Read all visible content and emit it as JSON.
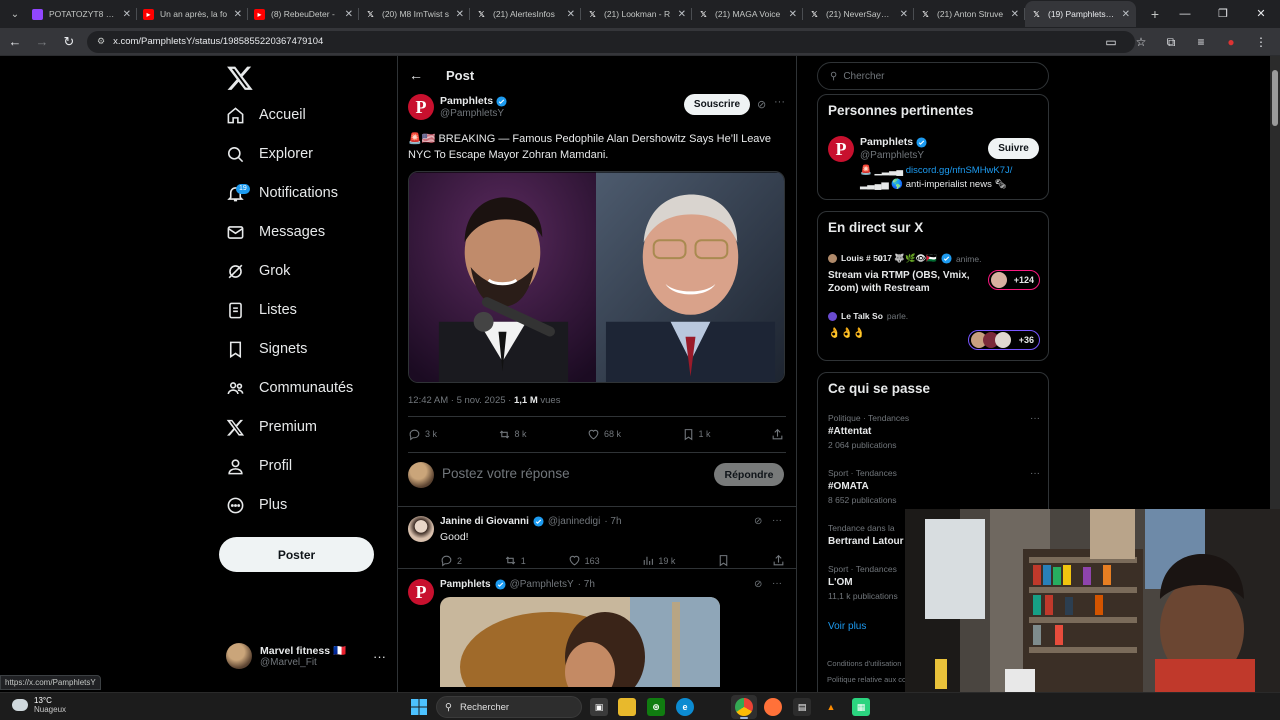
{
  "browser": {
    "tabs": [
      {
        "title": "POTATOZYT8 - Tw",
        "fav_color": "#9146ff",
        "active": false
      },
      {
        "title": "Un an après, la fo",
        "fav_color": "#ff0000",
        "active": false
      },
      {
        "title": "(8) RebeuDeter -",
        "fav_color": "#ff0000",
        "active": false
      },
      {
        "title": "(20) M8 ImTwist s",
        "fav_color": "#000000",
        "active": false
      },
      {
        "title": "(21) AlertesInfos",
        "fav_color": "#000000",
        "active": false
      },
      {
        "title": "(21) Lookman - R",
        "fav_color": "#000000",
        "active": false
      },
      {
        "title": "(21) MAGA Voice",
        "fav_color": "#000000",
        "active": false
      },
      {
        "title": "(21) NeverSayYes",
        "fav_color": "#000000",
        "active": false
      },
      {
        "title": "(21) Anton Struve",
        "fav_color": "#000000",
        "active": false
      },
      {
        "title": "(19) Pamphlets su",
        "fav_color": "#000000",
        "active": true
      }
    ],
    "url": "x.com/PamphletsY/status/1985855220367479104",
    "status_url": "https://x.com/PamphletsY"
  },
  "nav": {
    "items": [
      {
        "label": "Accueil",
        "icon": "home-icon"
      },
      {
        "label": "Explorer",
        "icon": "search-icon"
      },
      {
        "label": "Notifications",
        "icon": "bell-icon"
      },
      {
        "label": "Messages",
        "icon": "mail-icon"
      },
      {
        "label": "Grok",
        "icon": "grok-icon"
      },
      {
        "label": "Listes",
        "icon": "list-icon"
      },
      {
        "label": "Signets",
        "icon": "bookmark-icon"
      },
      {
        "label": "Communautés",
        "icon": "communities-icon"
      },
      {
        "label": "Premium",
        "icon": "x-premium-icon"
      },
      {
        "label": "Profil",
        "icon": "profile-icon"
      },
      {
        "label": "Plus",
        "icon": "more-circle-icon"
      }
    ],
    "notifications_badge": "19",
    "post_button": "Poster",
    "account": {
      "name": "Marvel fitness 🇫🇷",
      "handle": "@Marvel_Fit"
    }
  },
  "main": {
    "title": "Post",
    "author": {
      "name": "Pamphlets",
      "handle": "@PamphletsY"
    },
    "subscribe_label": "Souscrire",
    "text": "🚨🇺🇸 BREAKING — Famous Pedophile Alan Dershowitz Says He’ll Leave NYC To Escape Mayor Zohran Mamdani.",
    "time": "12:42 AM · 5 nov. 2025 · ",
    "views": "1,1 M",
    "views_label": " vues",
    "stats": {
      "replies": "3 k",
      "reposts": "8 k",
      "likes": "68 k",
      "bookmarks": "1 k"
    },
    "reply_placeholder": "Postez votre réponse",
    "reply_button": "Répondre",
    "replies": [
      {
        "name": "Janine di Giovanni",
        "handle": "@janinedigi",
        "time": "· 7h",
        "text": "Good!",
        "stats": {
          "replies": "2",
          "reposts": "1",
          "likes": "163",
          "views": "19 k"
        }
      },
      {
        "name": "Pamphlets",
        "handle": "@PamphletsY",
        "time": "· 7h"
      }
    ]
  },
  "right": {
    "search_placeholder": "Chercher",
    "relevant": {
      "title": "Personnes pertinentes",
      "name": "Pamphlets",
      "handle": "@PamphletsY",
      "follow": "Suivre",
      "bio_prefix": "🚨 ▁▂▃▄ ",
      "bio_link": "discord.gg/nfnSMHwK7J/",
      "bio_line2": "▂▃▄▅ 🌎 anti-imperialist news 🗞"
    },
    "live": {
      "title": "En direct sur X",
      "entries": [
        {
          "host": "Louis # 5𝟎17 🐺🌿👁🇵🇸",
          "action": "anime.",
          "title": "Stream via RTMP (OBS, Vmix, Zoom) with Restream",
          "count": "+124"
        },
        {
          "host": "Le Talk So",
          "action": "parle.",
          "title": "👌👌👌",
          "count": "+36"
        }
      ]
    },
    "trends": {
      "title": "Ce qui se passe",
      "items": [
        {
          "category": "Politique · Tendances",
          "tag": "#Attentat",
          "count": "2 064 publications"
        },
        {
          "category": "Sport · Tendances",
          "tag": "#OMATA",
          "count": "8 652 publications"
        },
        {
          "category": "Tendance dans la",
          "tag": "Bertrand Latour",
          "count": ""
        },
        {
          "category": "Sport · Tendances",
          "tag": "L'OM",
          "count": "11,1 k publications"
        }
      ],
      "see_more": "Voir plus"
    },
    "footer": {
      "line1": "Conditions d'utilisation",
      "line2": "Politique relative aux co"
    }
  },
  "taskbar": {
    "temp": "13°C",
    "condition": "Nuageux",
    "search": "Rechercher"
  },
  "colors": {
    "accent": "#1d9bf0",
    "background": "#000000",
    "like": "#f91880"
  }
}
